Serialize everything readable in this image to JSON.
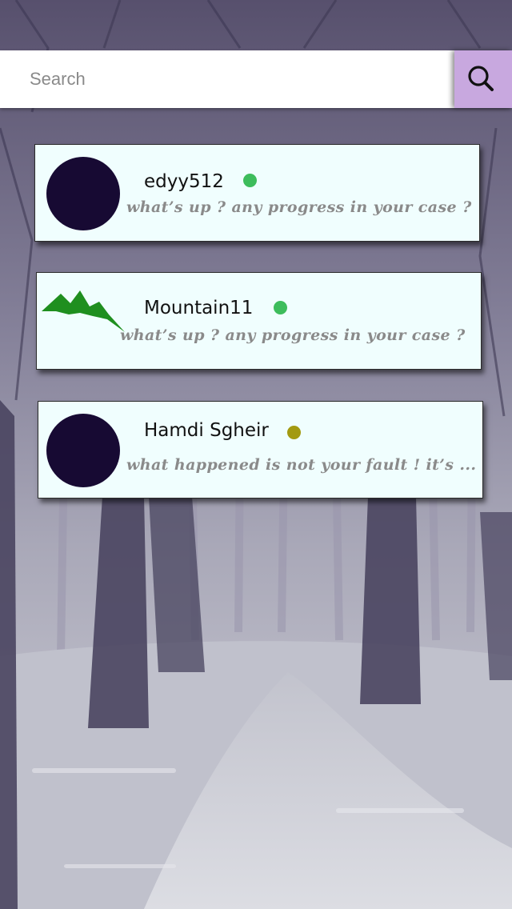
{
  "search": {
    "placeholder": "Search",
    "button_color": "#c8a8df"
  },
  "conversations": [
    {
      "name": "edyy512",
      "status": "online",
      "status_color": "#3dbd5c",
      "message": "what’s up ? any  progress in your case ?",
      "avatar": "dark-circle"
    },
    {
      "name": "Mountain11",
      "status": "online",
      "status_color": "#3dbd5c",
      "message": "what’s up ? any  progress in your case ?",
      "avatar": "mountain-logo"
    },
    {
      "name": "Hamdi Sgheir",
      "status": "away",
      "status_color": "#a39a10",
      "message": "what happened is not your fault ! it’s ...",
      "avatar": "dark-circle"
    }
  ],
  "colors": {
    "card_background": "#f0fefe",
    "avatar": "#170a33",
    "message_text": "#8a8a8a",
    "mountain_logo": "#1f8f1f"
  }
}
